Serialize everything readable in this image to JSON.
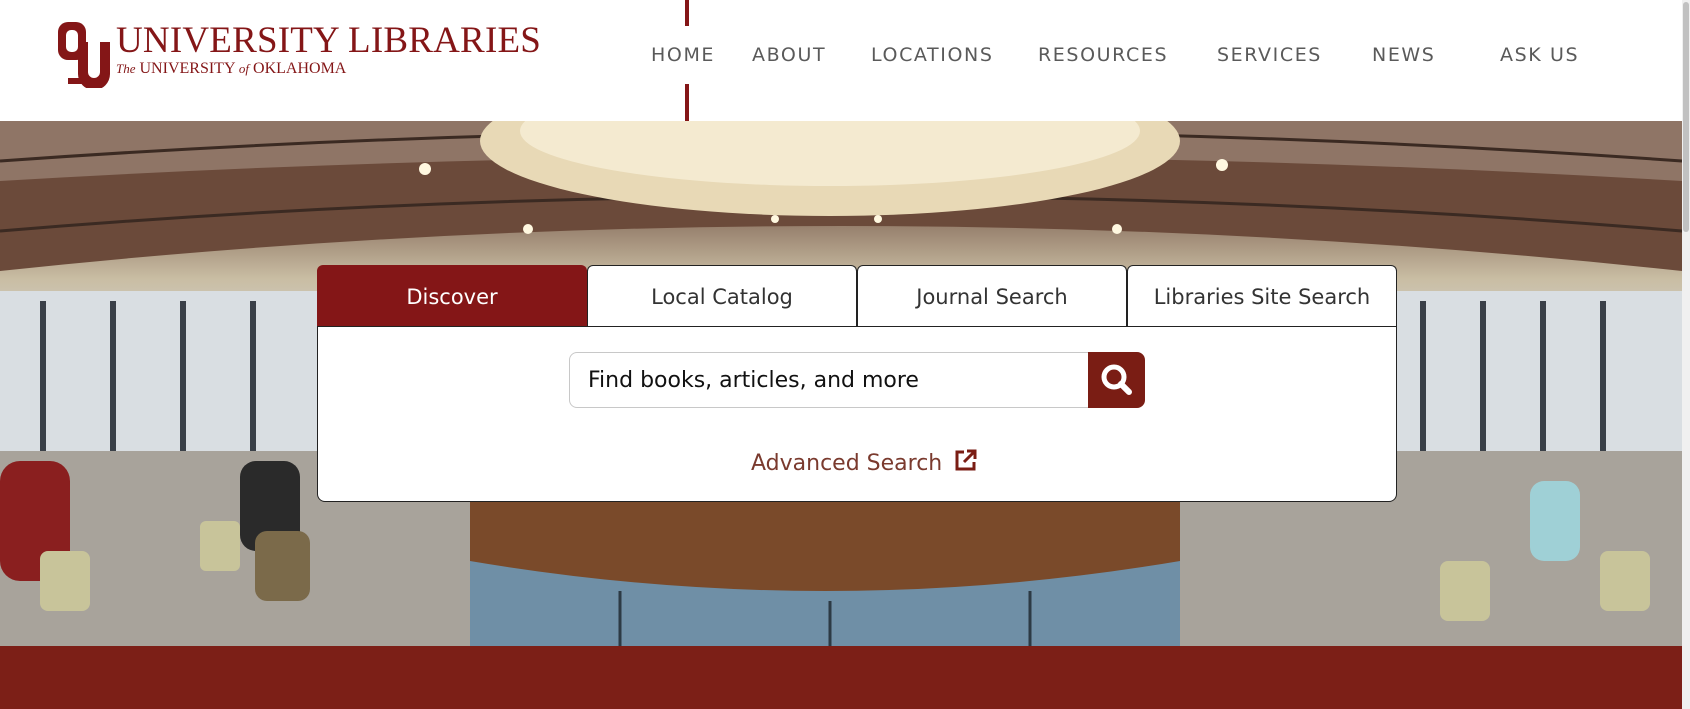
{
  "logo": {
    "title": "UNIVERSITY LIBRARIES",
    "sub_the": "The",
    "sub_university": "UNIVERSITY",
    "sub_of": "of",
    "sub_state": "OKLAHOMA"
  },
  "nav": {
    "items": [
      "HOME",
      "ABOUT",
      "LOCATIONS",
      "RESOURCES",
      "SERVICES",
      "NEWS",
      "ASK US"
    ]
  },
  "search": {
    "tabs": [
      "Discover",
      "Local Catalog",
      "Journal Search",
      "Libraries Site Search"
    ],
    "active_tab": "Discover",
    "placeholder": "Find books, articles, and more",
    "button_icon": "search-icon",
    "advanced_label": "Advanced Search",
    "advanced_icon": "external-link-icon"
  },
  "colors": {
    "crimson": "#841617",
    "band": "#7c1f17"
  }
}
